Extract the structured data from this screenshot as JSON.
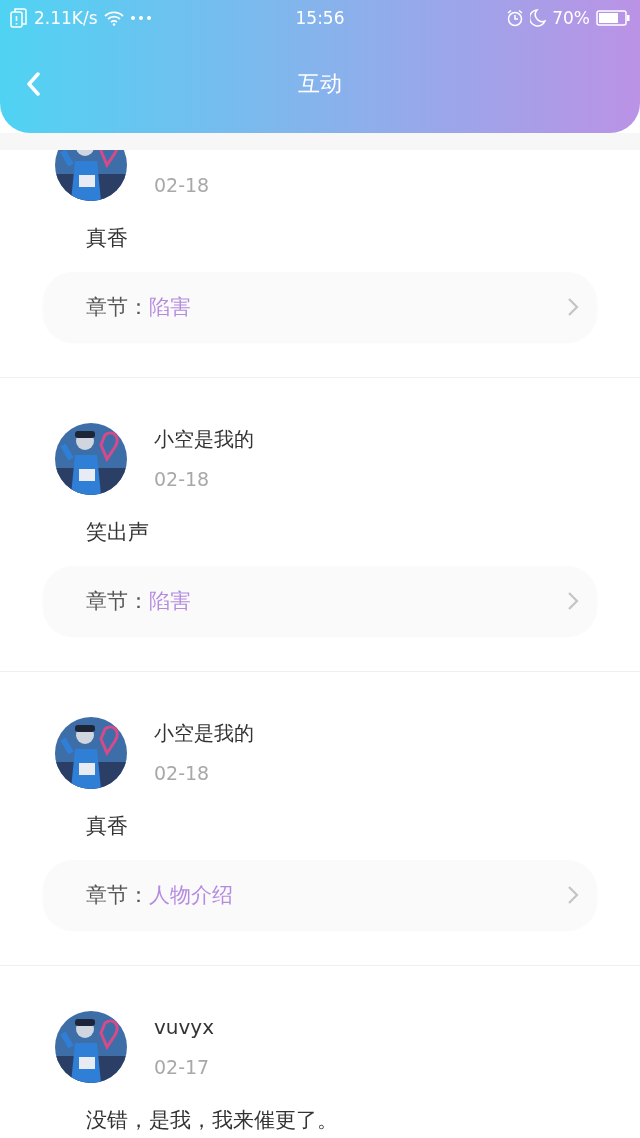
{
  "status_bar": {
    "speed": "2.11K/s",
    "time": "15:56",
    "battery": "70%"
  },
  "header": {
    "title": "互动"
  },
  "comments": [
    {
      "date": "02-18",
      "text": "真香",
      "chapter_label": "章节：",
      "chapter": "陷害"
    },
    {
      "name": "小空是我的",
      "date": "02-18",
      "text": "笑出声",
      "chapter_label": "章节：",
      "chapter": "陷害"
    },
    {
      "name": "小空是我的",
      "date": "02-18",
      "text": "真香",
      "chapter_label": "章节：",
      "chapter": "人物介绍"
    },
    {
      "name": "vuvyx",
      "date": "02-17",
      "text": "没错，是我，我来催更了。"
    }
  ]
}
